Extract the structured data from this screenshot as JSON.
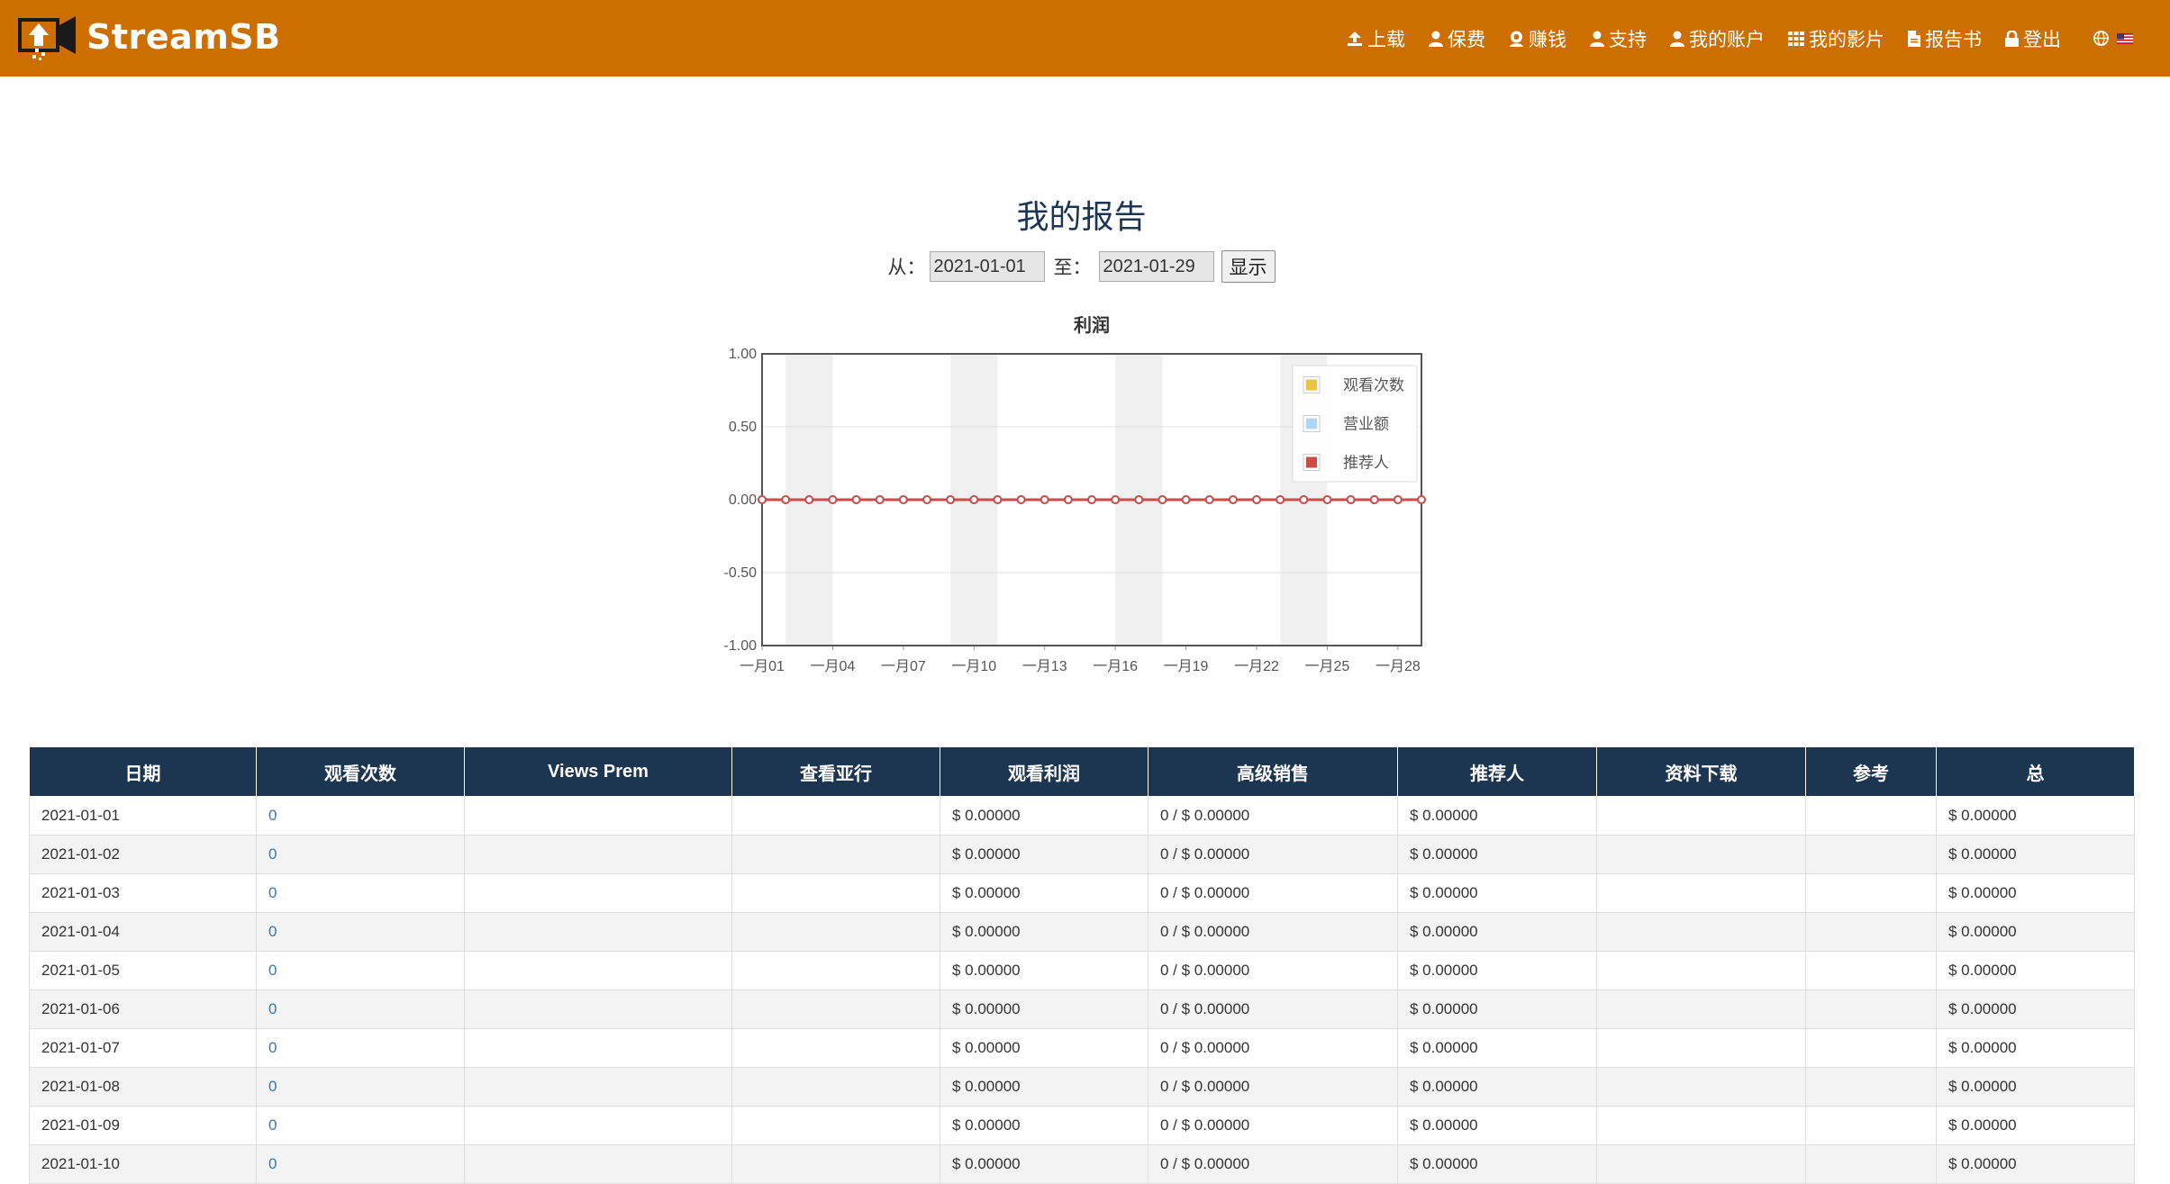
{
  "brand": {
    "name": "StreamSB"
  },
  "nav": [
    {
      "label": "上载",
      "icon": "upload-icon"
    },
    {
      "label": "保费",
      "icon": "user-icon"
    },
    {
      "label": "赚钱",
      "icon": "money-user-icon"
    },
    {
      "label": "支持",
      "icon": "user-icon"
    },
    {
      "label": "我的账户",
      "icon": "user-icon"
    },
    {
      "label": "我的影片",
      "icon": "grid-icon"
    },
    {
      "label": "报告书",
      "icon": "file-icon"
    },
    {
      "label": "登出",
      "icon": "lock-icon"
    }
  ],
  "language": {
    "icon": "globe-icon",
    "flag": "us-flag-icon"
  },
  "page": {
    "title": "我的报告"
  },
  "form": {
    "from_label": "从：",
    "from_value": "2021-01-01",
    "to_label": "至：",
    "to_value": "2021-01-29",
    "submit_label": "显示"
  },
  "chart_data": {
    "type": "line",
    "title": "利润",
    "xlabel": "",
    "ylabel": "",
    "ylim": [
      -1,
      1
    ],
    "yticks": [
      "1.00",
      "0.50",
      "0.00",
      "-0.50",
      "-1.00"
    ],
    "x": [
      "2021-01-01",
      "2021-01-02",
      "2021-01-03",
      "2021-01-04",
      "2021-01-05",
      "2021-01-06",
      "2021-01-07",
      "2021-01-08",
      "2021-01-09",
      "2021-01-10",
      "2021-01-11",
      "2021-01-12",
      "2021-01-13",
      "2021-01-14",
      "2021-01-15",
      "2021-01-16",
      "2021-01-17",
      "2021-01-18",
      "2021-01-19",
      "2021-01-20",
      "2021-01-21",
      "2021-01-22",
      "2021-01-23",
      "2021-01-24",
      "2021-01-25",
      "2021-01-26",
      "2021-01-27",
      "2021-01-28",
      "2021-01-29"
    ],
    "xtick_labels": [
      "一月01",
      "一月04",
      "一月07",
      "一月10",
      "一月13",
      "一月16",
      "一月19",
      "一月22",
      "一月25",
      "一月28"
    ],
    "series": [
      {
        "name": "观看次数",
        "color": "#edc240",
        "values": [
          0,
          0,
          0,
          0,
          0,
          0,
          0,
          0,
          0,
          0,
          0,
          0,
          0,
          0,
          0,
          0,
          0,
          0,
          0,
          0,
          0,
          0,
          0,
          0,
          0,
          0,
          0,
          0,
          0
        ]
      },
      {
        "name": "营业额",
        "color": "#afd8f8",
        "values": [
          0,
          0,
          0,
          0,
          0,
          0,
          0,
          0,
          0,
          0,
          0,
          0,
          0,
          0,
          0,
          0,
          0,
          0,
          0,
          0,
          0,
          0,
          0,
          0,
          0,
          0,
          0,
          0,
          0
        ]
      },
      {
        "name": "推荐人",
        "color": "#cb4b4b",
        "values": [
          0,
          0,
          0,
          0,
          0,
          0,
          0,
          0,
          0,
          0,
          0,
          0,
          0,
          0,
          0,
          0,
          0,
          0,
          0,
          0,
          0,
          0,
          0,
          0,
          0,
          0,
          0,
          0,
          0
        ]
      }
    ],
    "weekend_bands": [
      "2021-01-02",
      "2021-01-09",
      "2021-01-16",
      "2021-01-23"
    ],
    "grid": true,
    "legend": "top-right"
  },
  "table": {
    "headers": [
      "日期",
      "观看次数",
      "Views Prem",
      "查看亚行",
      "观看利润",
      "高级销售",
      "推荐人",
      "资料下载",
      "参考",
      "总"
    ],
    "rows": [
      [
        "2021-01-01",
        "0",
        "",
        "",
        "$ 0.00000",
        "0 / $ 0.00000",
        "$ 0.00000",
        "",
        "",
        "$ 0.00000"
      ],
      [
        "2021-01-02",
        "0",
        "",
        "",
        "$ 0.00000",
        "0 / $ 0.00000",
        "$ 0.00000",
        "",
        "",
        "$ 0.00000"
      ],
      [
        "2021-01-03",
        "0",
        "",
        "",
        "$ 0.00000",
        "0 / $ 0.00000",
        "$ 0.00000",
        "",
        "",
        "$ 0.00000"
      ],
      [
        "2021-01-04",
        "0",
        "",
        "",
        "$ 0.00000",
        "0 / $ 0.00000",
        "$ 0.00000",
        "",
        "",
        "$ 0.00000"
      ],
      [
        "2021-01-05",
        "0",
        "",
        "",
        "$ 0.00000",
        "0 / $ 0.00000",
        "$ 0.00000",
        "",
        "",
        "$ 0.00000"
      ],
      [
        "2021-01-06",
        "0",
        "",
        "",
        "$ 0.00000",
        "0 / $ 0.00000",
        "$ 0.00000",
        "",
        "",
        "$ 0.00000"
      ],
      [
        "2021-01-07",
        "0",
        "",
        "",
        "$ 0.00000",
        "0 / $ 0.00000",
        "$ 0.00000",
        "",
        "",
        "$ 0.00000"
      ],
      [
        "2021-01-08",
        "0",
        "",
        "",
        "$ 0.00000",
        "0 / $ 0.00000",
        "$ 0.00000",
        "",
        "",
        "$ 0.00000"
      ],
      [
        "2021-01-09",
        "0",
        "",
        "",
        "$ 0.00000",
        "0 / $ 0.00000",
        "$ 0.00000",
        "",
        "",
        "$ 0.00000"
      ],
      [
        "2021-01-10",
        "0",
        "",
        "",
        "$ 0.00000",
        "0 / $ 0.00000",
        "$ 0.00000",
        "",
        "",
        "$ 0.00000"
      ]
    ]
  },
  "colors": {
    "navbar": "#cc6e00",
    "table_header": "#1c3551",
    "title": "#1b3553",
    "link": "#337ab7"
  }
}
